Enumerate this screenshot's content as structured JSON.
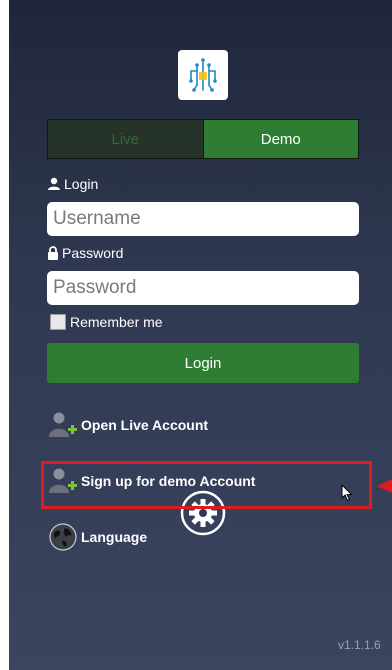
{
  "tabs": {
    "live": "Live",
    "demo": "Demo"
  },
  "login_label": "Login",
  "username": {
    "placeholder": "Username"
  },
  "password_label": "Password",
  "password": {
    "placeholder": "Password"
  },
  "remember_label": "Remember me",
  "login_button": "Login",
  "menu": {
    "open_live": "Open Live Account",
    "signup_demo": "Sign up for demo Account",
    "language": "Language"
  },
  "version": "v1.1.1.6",
  "colors": {
    "accent": "#2e7d32",
    "highlight": "#e01b1b"
  }
}
